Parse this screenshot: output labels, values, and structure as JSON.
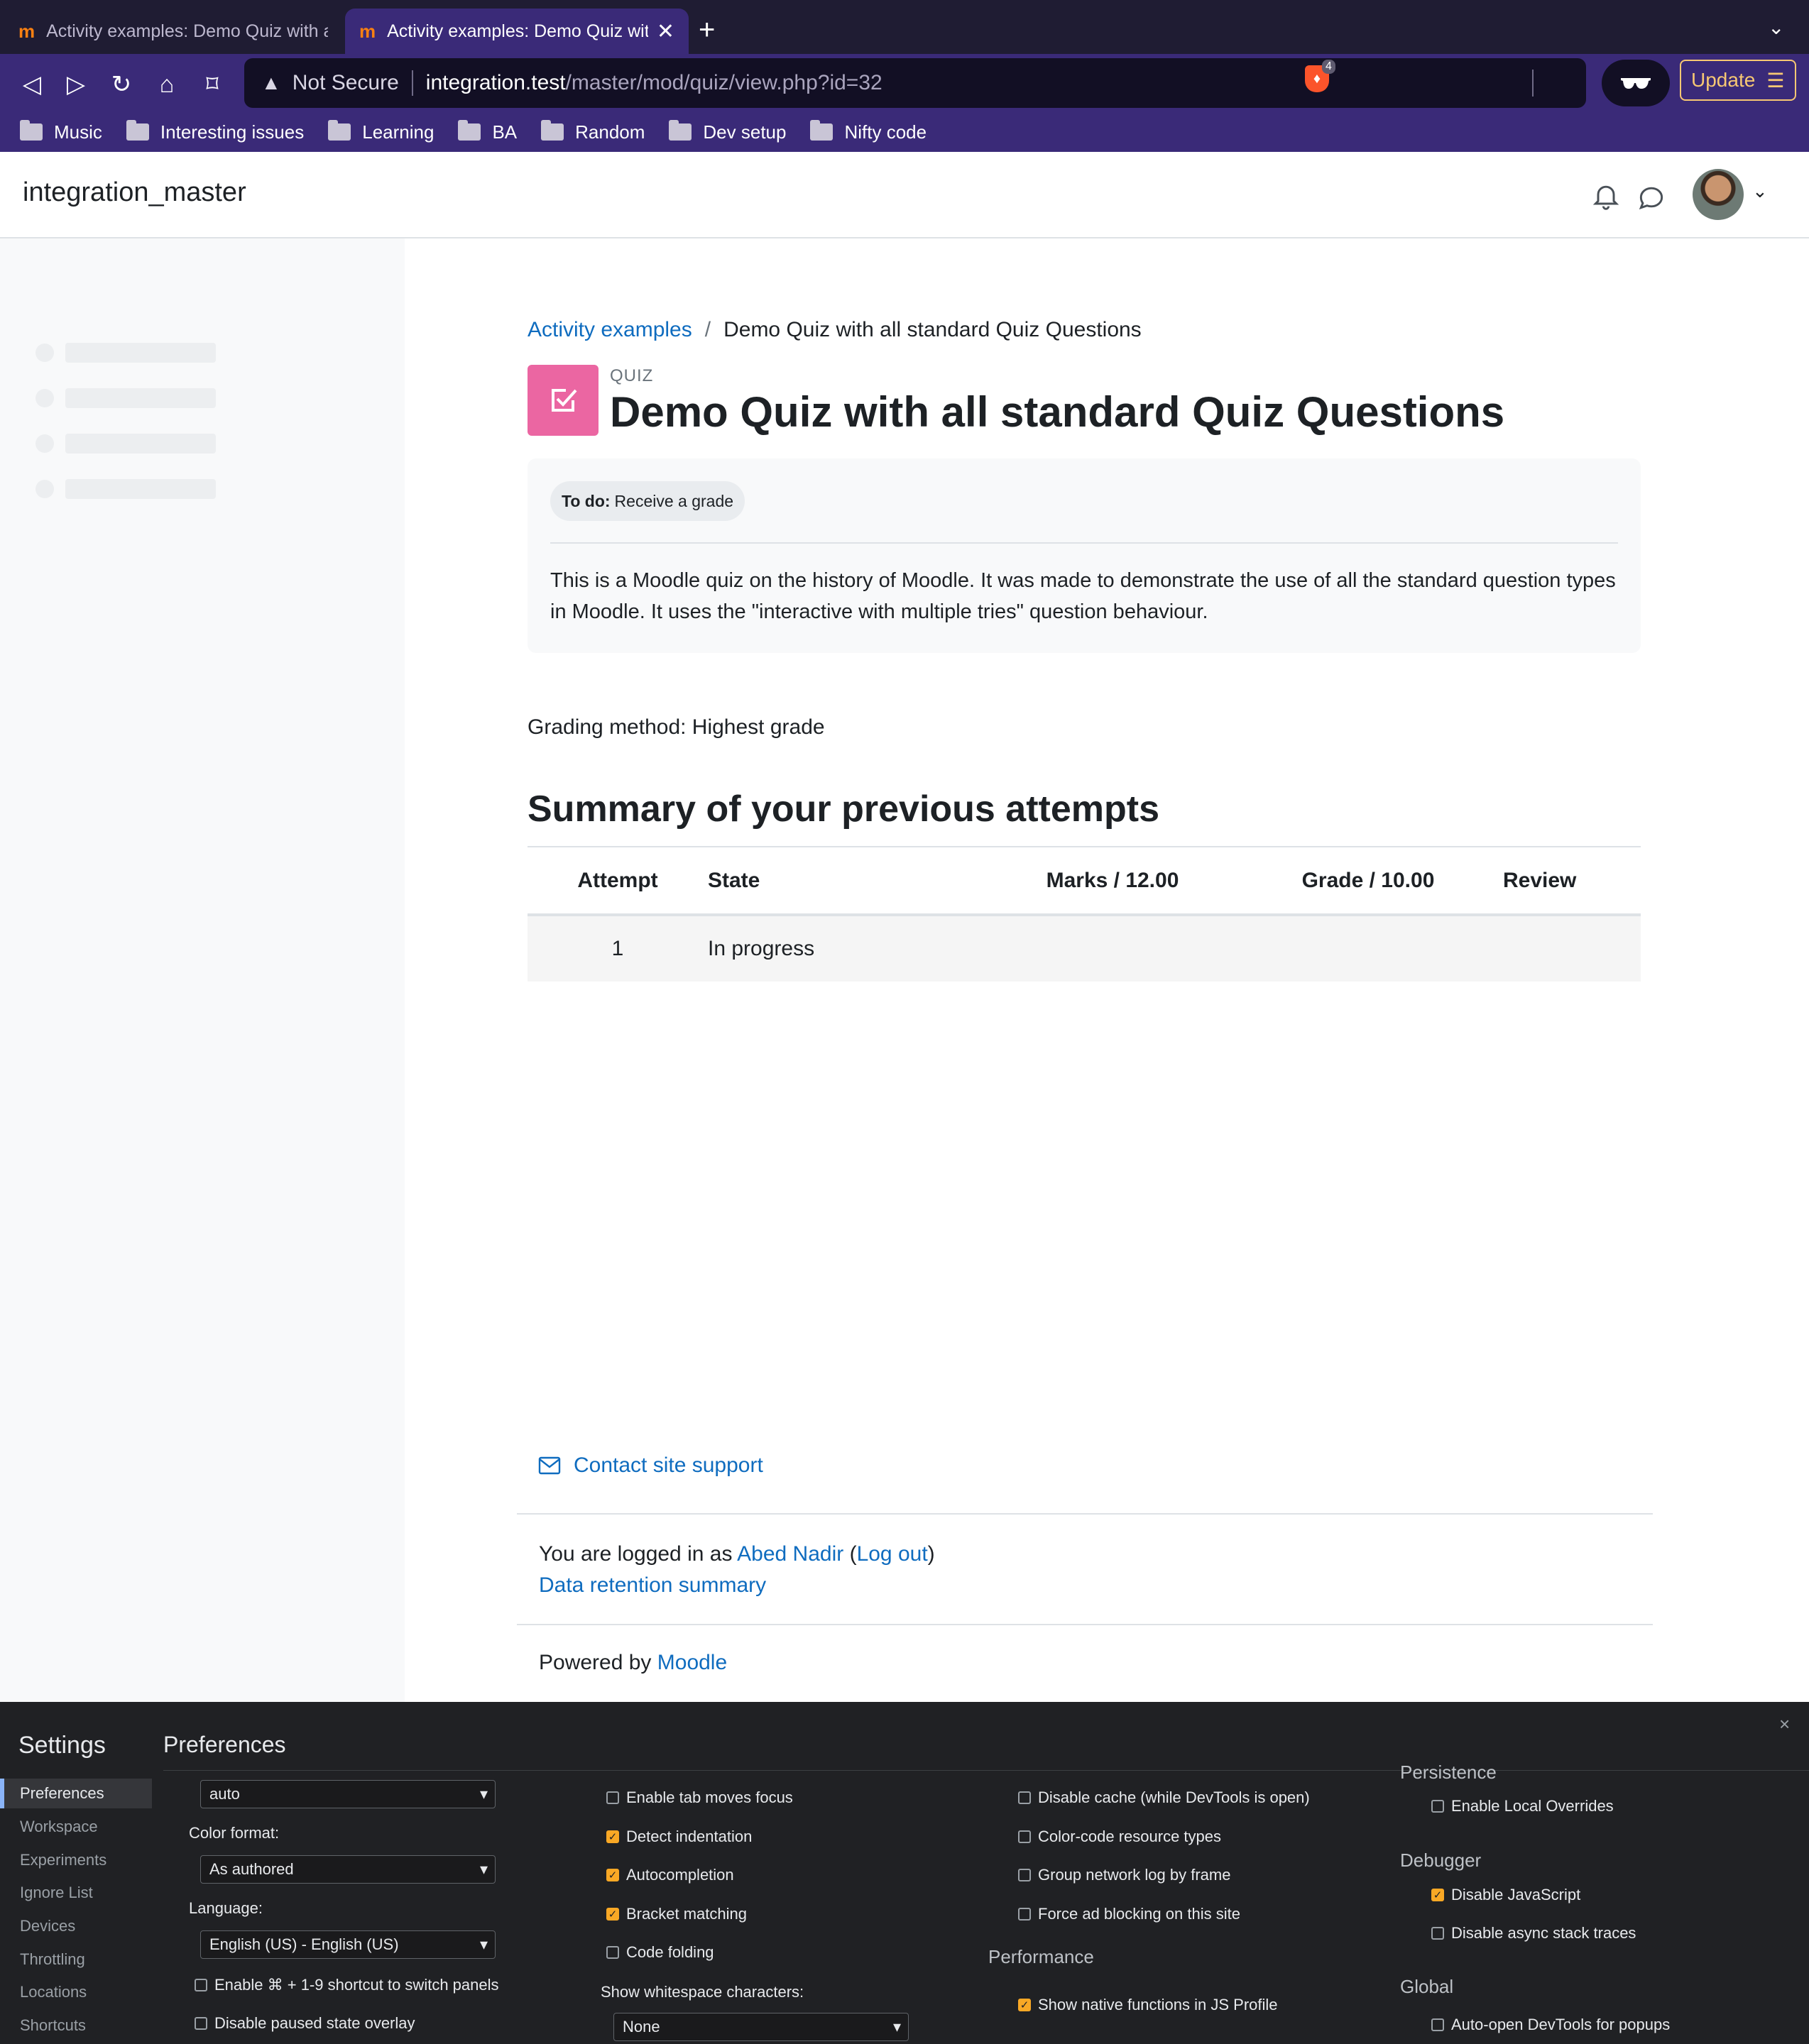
{
  "browser": {
    "tabs": [
      {
        "title": "Activity examples: Demo Quiz with all standard Quiz Questions",
        "active": false
      },
      {
        "title": "Activity examples: Demo Quiz with all standard Quiz Questions",
        "active": true
      }
    ],
    "tab_favicon": "m",
    "tab_close": "✕",
    "new_tab": "+",
    "tab_list": "⌄",
    "nav": {
      "back": "◁",
      "forward": "▷",
      "reload": "↻",
      "home": "⌂",
      "bookmark": "⌑"
    },
    "address": {
      "security_label": "Not Secure",
      "host": "integration.test",
      "path": "/master/mod/quiz/view.php?id=32"
    },
    "shield_count": "4",
    "update_label": "Update",
    "update_menu": "☰",
    "bookmarks": [
      "Music",
      "Interesting issues",
      "Learning",
      "BA",
      "Random",
      "Dev setup",
      "Nifty code"
    ]
  },
  "header": {
    "site_name": "integration_master",
    "user_menu_caret": "⌄"
  },
  "breadcrumb": {
    "parent": "Activity examples",
    "separator": "/",
    "current": "Demo Quiz with all standard Quiz Questions"
  },
  "activity": {
    "module_type": "QUIZ",
    "title": "Demo Quiz with all standard Quiz Questions",
    "todo_label": "To do:",
    "todo_value": "Receive a grade",
    "intro": "This is a Moodle quiz on the history of Moodle. It was made to demonstrate the use of all the standard question types in Moodle. It uses the \"interactive with multiple tries\" question behaviour.",
    "grading_method": "Grading method: Highest grade"
  },
  "summary": {
    "heading": "Summary of your previous attempts",
    "columns": [
      "Attempt",
      "State",
      "Marks / 12.00",
      "Grade / 10.00",
      "Review"
    ],
    "rows": [
      {
        "attempt": "1",
        "state": "In progress",
        "marks": "",
        "grade": "",
        "review": ""
      }
    ]
  },
  "footer": {
    "contact_support": "Contact site support",
    "logged_in_prefix": "You are logged in as ",
    "user_name": "Abed Nadir",
    "logout_open": " (",
    "logout_label": "Log out",
    "logout_close": ")",
    "data_retention": "Data retention summary",
    "powered_by": "Powered by ",
    "moodle_link": "Moodle"
  },
  "devtools": {
    "title": "Settings",
    "close": "×",
    "panel_title": "Preferences",
    "nav": [
      "Preferences",
      "Workspace",
      "Experiments",
      "Ignore List",
      "Devices",
      "Throttling",
      "Locations",
      "Shortcuts"
    ],
    "active_nav": "Preferences",
    "col1": {
      "theme_value": "auto",
      "color_format_label": "Color format:",
      "color_format_value": "As authored",
      "language_label": "Language:",
      "language_value": "English (US) - English (US)",
      "checks": [
        {
          "label": "Enable ⌘ + 1-9 shortcut to switch panels",
          "checked": false
        },
        {
          "label": "Disable paused state overlay",
          "checked": false
        }
      ]
    },
    "col2": {
      "checks": [
        {
          "label": "Enable tab moves focus",
          "checked": false
        },
        {
          "label": "Detect indentation",
          "checked": true
        },
        {
          "label": "Autocompletion",
          "checked": true
        },
        {
          "label": "Bracket matching",
          "checked": true
        },
        {
          "label": "Code folding",
          "checked": false
        }
      ],
      "whitespace_label": "Show whitespace characters:",
      "whitespace_value": "None"
    },
    "col3": {
      "checks": [
        {
          "label": "Disable cache (while DevTools is open)",
          "checked": false
        },
        {
          "label": "Color-code resource types",
          "checked": false
        },
        {
          "label": "Group network log by frame",
          "checked": false
        },
        {
          "label": "Force ad blocking on this site",
          "checked": false
        }
      ],
      "performance_heading": "Performance",
      "performance_checks": [
        {
          "label": "Show native functions in JS Profile",
          "checked": true
        }
      ]
    },
    "col4": {
      "persistence_heading": "Persistence",
      "persistence_checks": [
        {
          "label": "Enable Local Overrides",
          "checked": false
        }
      ],
      "debugger_heading": "Debugger",
      "debugger_checks": [
        {
          "label": "Disable JavaScript",
          "checked": true
        },
        {
          "label": "Disable async stack traces",
          "checked": false
        }
      ],
      "global_heading": "Global",
      "global_checks": [
        {
          "label": "Auto-open DevTools for popups",
          "checked": false
        }
      ]
    }
  }
}
